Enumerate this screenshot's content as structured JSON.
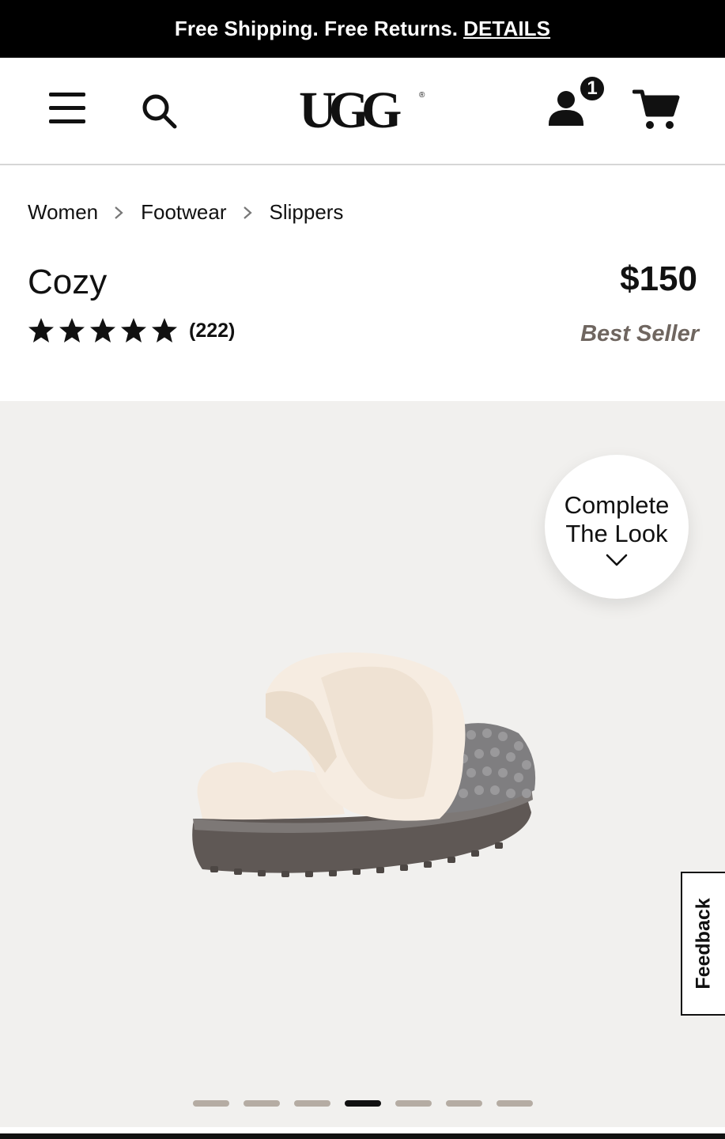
{
  "promo": {
    "text": "Free Shipping. Free Returns.",
    "link_label": "DETAILS"
  },
  "header": {
    "logo_text": "UGG",
    "account_badge_count": "1",
    "icons": [
      "menu-icon",
      "search-icon",
      "account-icon",
      "cart-icon"
    ]
  },
  "breadcrumb": {
    "items": [
      {
        "label": "Women"
      },
      {
        "label": "Footwear"
      },
      {
        "label": "Slippers"
      }
    ]
  },
  "product": {
    "title": "Cozy",
    "price": "$150",
    "rating_stars": 5,
    "review_count": "(222)",
    "badge": "Best Seller"
  },
  "gallery": {
    "complete_look_line1": "Complete",
    "complete_look_line2": "The Look",
    "image_count": 7,
    "active_index": 3
  },
  "feedback": {
    "label": "Feedback"
  },
  "colors": {
    "promo_bg": "#000000",
    "gallery_bg": "#f1f0ee",
    "best_seller": "#6f6660",
    "dot_inactive": "#b5aca3",
    "dot_active": "#111111"
  }
}
